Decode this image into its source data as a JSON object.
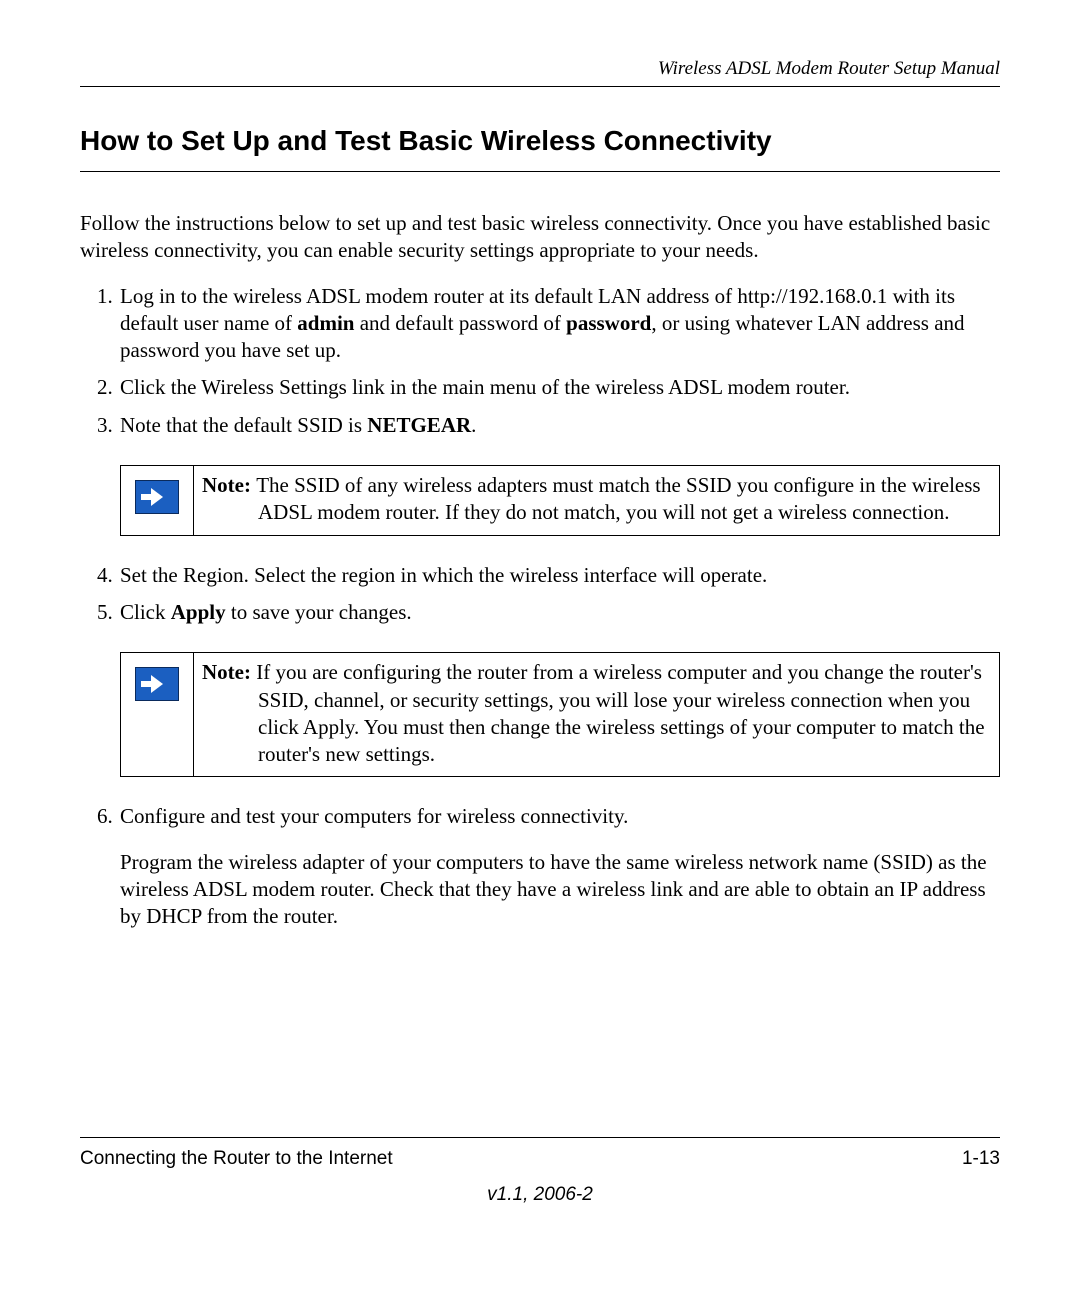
{
  "header": {
    "manual_title": "Wireless ADSL Modem Router Setup Manual"
  },
  "section": {
    "title": "How to Set Up and Test Basic Wireless Connectivity",
    "intro": "Follow the instructions below to set up and test basic wireless connectivity. Once you have established basic wireless connectivity, you can enable security settings appropriate to your needs."
  },
  "steps": {
    "s1_pre": "Log in to the wireless ADSL modem router at its default LAN address of http://192.168.0.1 with its default user name of ",
    "s1_bold1": "admin",
    "s1_mid": " and default password of ",
    "s1_bold2": "password",
    "s1_post": ", or using whatever LAN address and password you have set up.",
    "s2": "Click the Wireless Settings link in the main menu of the wireless ADSL modem router.",
    "s3_pre": "Note that the default SSID is ",
    "s3_bold": "NETGEAR",
    "s3_post": ".",
    "s4": "Set the Region. Select the region in which the wireless interface will operate.",
    "s5_pre": "Click ",
    "s5_bold": "Apply",
    "s5_post": " to save your changes.",
    "s6a": "Configure and test your computers for wireless connectivity.",
    "s6b": "Program the wireless adapter of your computers to have the same wireless network name (SSID) as the wireless ADSL modem router. Check that they have a wireless link and are able to obtain an IP address by DHCP from the router."
  },
  "notes": {
    "n1_label": "Note: ",
    "n1_body": "The SSID of any wireless adapters must match the SSID you configure in the wireless ADSL modem router. If they do not match, you will not get a wireless connection.",
    "n2_label": "Note: ",
    "n2_body": "If you are configuring the router from a wireless computer and you change the router's SSID, channel, or security settings, you will lose your wireless connection when you click Apply. You must then change the wireless settings of your computer to match the router's new settings."
  },
  "footer": {
    "left": "Connecting the Router to the Internet",
    "right": "1-13",
    "version": "v1.1, 2006-2"
  }
}
